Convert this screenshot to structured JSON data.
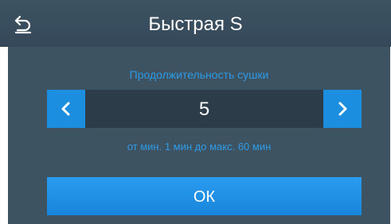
{
  "header": {
    "title": "Быстрая S",
    "back_icon": "back-arrow-icon"
  },
  "setting": {
    "label": "Продолжительность сушки",
    "value": "5",
    "range_text": "от мин. 1 мин до макс. 60 мин",
    "decrement_icon": "chevron-left-icon",
    "increment_icon": "chevron-right-icon"
  },
  "actions": {
    "ok_label": "ОК"
  },
  "colors": {
    "header_bg": "#3d5361",
    "content_bg": "#3d5361",
    "stepper_bg": "#2d3c49",
    "accent": "#1c8ee0",
    "label_text": "#2f9ae6"
  }
}
